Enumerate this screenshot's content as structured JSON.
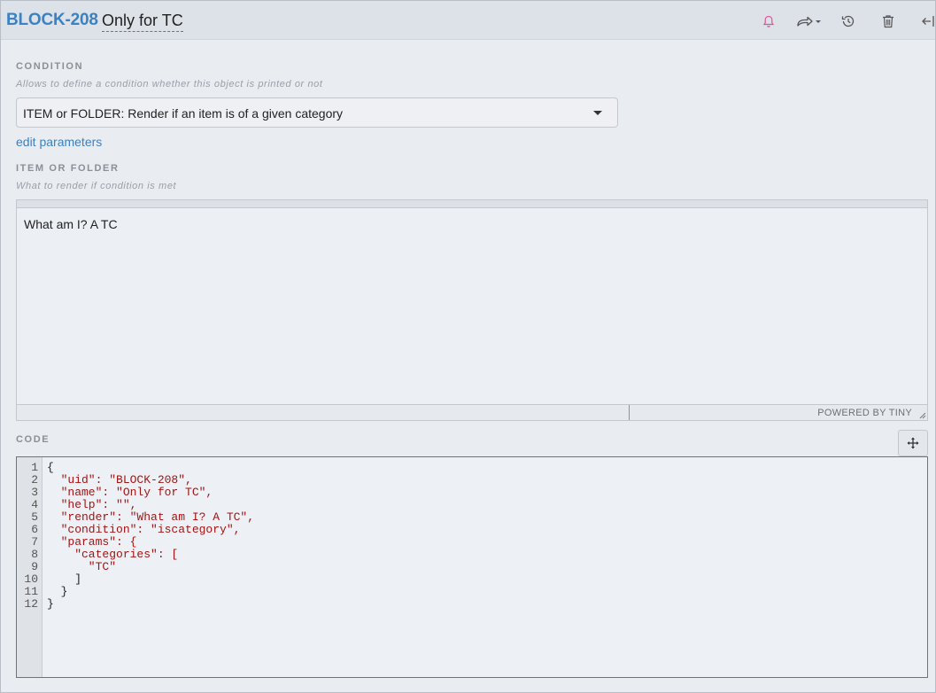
{
  "header": {
    "uid": "BLOCK-208",
    "name": "Only for TC",
    "icons": [
      "bell-icon",
      "share-icon",
      "history-icon",
      "trash-icon",
      "collapse-icon"
    ],
    "bell_color": "#e0529c"
  },
  "condition": {
    "label": "CONDITION",
    "help": "Allows to define a condition whether this object is printed or not",
    "select_value": "ITEM or FOLDER: Render if an item is of a given category",
    "edit_link": "edit parameters"
  },
  "item_or_folder": {
    "label": "ITEM OR FOLDER",
    "help": "What to render if condition is met",
    "content": "What am I? A TC",
    "powered_by": "POWERED BY TINY"
  },
  "code": {
    "label": "CODE",
    "line_numbers": [
      "1",
      "2",
      "3",
      "4",
      "5",
      "6",
      "7",
      "8",
      "9",
      "10",
      "11",
      "12"
    ],
    "lines": [
      "{",
      "  \"uid\": \"BLOCK-208\",",
      "  \"name\": \"Only for TC\",",
      "  \"help\": \"\",",
      "  \"render\": \"What am I? A TC\",",
      "  \"condition\": \"iscategory\",",
      "  \"params\": {",
      "    \"categories\": [",
      "      \"TC\"",
      "    ]",
      "  }",
      "}"
    ]
  }
}
